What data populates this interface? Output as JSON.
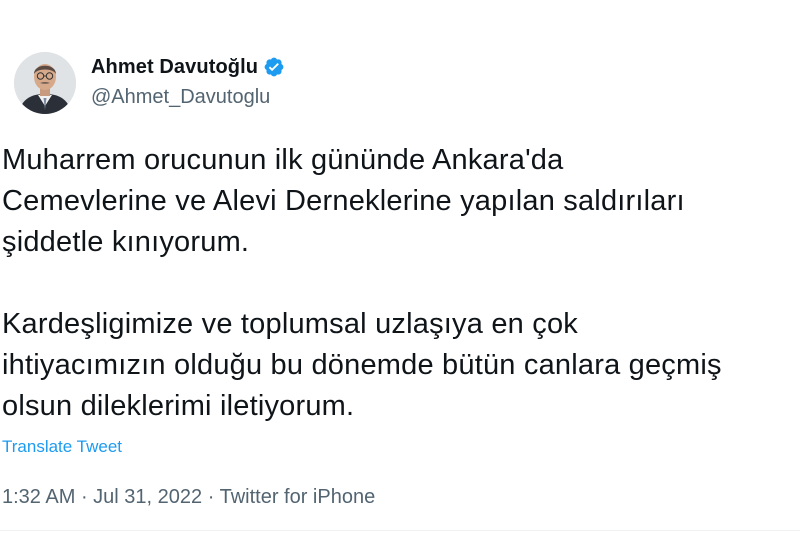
{
  "author": {
    "display_name": "Ahmet Davutoğlu",
    "handle": "@Ahmet_Davutoglu",
    "verified": true,
    "verified_color": "#1d9bf0"
  },
  "tweet": {
    "paragraph_1": "Muharrem orucunun ilk gününde Ankara'da\nCemevlerine ve Alevi Derneklerine yapılan saldırıları\nşiddetle kınıyorum.",
    "paragraph_2": "Kardeşligimize ve toplumsal uzlaşıya en çok\nihtiyacımızın olduğu bu dönemde bütün canlara geçmiş\nolsun dileklerimi iletiyorum."
  },
  "translate_label": "Translate Tweet",
  "meta": {
    "time": "1:32 AM",
    "separator": " · ",
    "date": "Jul 31, 2022",
    "source": "Twitter for iPhone"
  },
  "colors": {
    "text": "#0f1419",
    "secondary": "#536471",
    "link": "#1d9bf0"
  },
  "icons": {
    "avatar": "profile-photo",
    "verified": "verified-badge-icon"
  }
}
